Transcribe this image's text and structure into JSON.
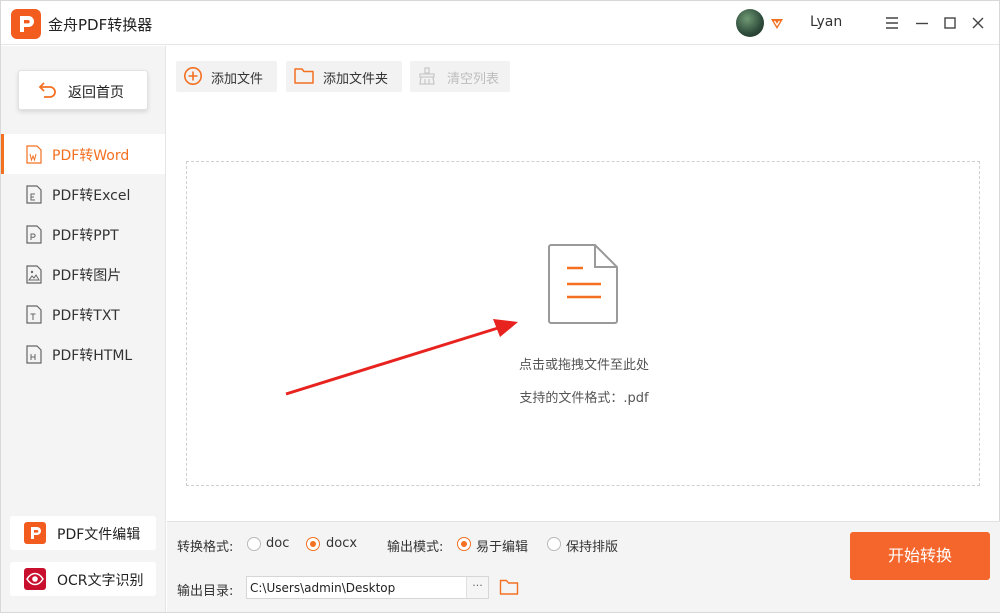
{
  "app": {
    "title": "金舟PDF转换器"
  },
  "user": {
    "name": "Lyan",
    "badge_icon": "vip-badge-icon"
  },
  "window_controls": [
    "menu-icon",
    "minimize-icon",
    "maximize-icon",
    "close-icon"
  ],
  "sidebar": {
    "home_label": "返回首页",
    "items": [
      {
        "label": "PDF转Word",
        "icon": "word-file-icon",
        "active": true
      },
      {
        "label": "PDF转Excel",
        "icon": "excel-file-icon",
        "active": false
      },
      {
        "label": "PDF转PPT",
        "icon": "ppt-file-icon",
        "active": false
      },
      {
        "label": "PDF转图片",
        "icon": "image-file-icon",
        "active": false
      },
      {
        "label": "PDF转TXT",
        "icon": "txt-file-icon",
        "active": false
      },
      {
        "label": "PDF转HTML",
        "icon": "html-file-icon",
        "active": false
      }
    ],
    "tools": [
      {
        "label": "PDF文件编辑",
        "icon": "pdf-edit-icon"
      },
      {
        "label": "OCR文字识别",
        "icon": "ocr-eye-icon"
      }
    ]
  },
  "toolbar": {
    "add_file": "添加文件",
    "add_folder": "添加文件夹",
    "clear_list": "清空列表"
  },
  "dropzone": {
    "hint": "点击或拖拽文件至此处",
    "formats": "支持的文件格式：.pdf"
  },
  "options": {
    "format_label": "转换格式:",
    "formats": [
      {
        "label": "doc",
        "selected": false
      },
      {
        "label": "docx",
        "selected": true
      }
    ],
    "mode_label": "输出模式:",
    "modes": [
      {
        "label": "易于编辑",
        "selected": true
      },
      {
        "label": "保持排版",
        "selected": false
      }
    ],
    "output_label": "输出目录:",
    "output_path": "C:\\Users\\admin\\Desktop",
    "browse_label": "···"
  },
  "start_button": "开始转换",
  "colors": {
    "accent": "#f37021",
    "start": "#f4662b",
    "arrow": "#e8231f"
  }
}
